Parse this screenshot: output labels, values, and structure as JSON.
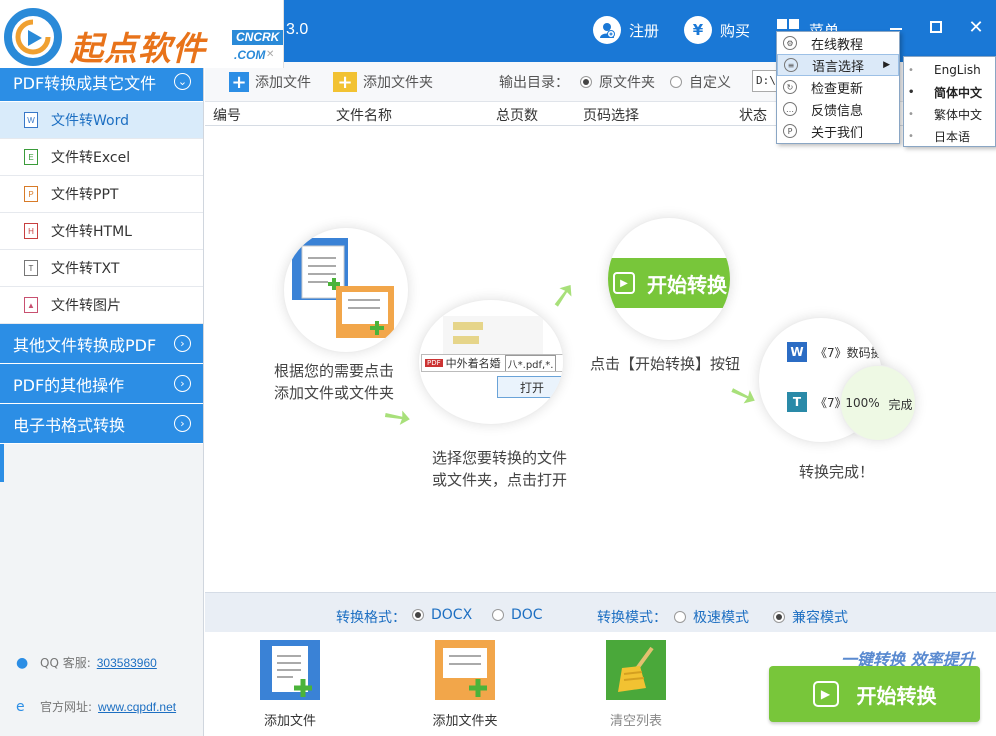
{
  "app": {
    "logo_text": "起点软件",
    "logo_badge": "CNCRK",
    "logo_domain": ".COM",
    "version_suffix": "3.0"
  },
  "titlebar": {
    "register": "注册",
    "buy": "购买",
    "menu": "菜单"
  },
  "dropdown": {
    "items": [
      "在线教程",
      "语言选择",
      "检查更新",
      "反馈信息",
      "关于我们"
    ]
  },
  "language_submenu": {
    "items": [
      "EngLish",
      "简体中文",
      "繁体中文",
      "日本语"
    ],
    "selected": "简体中文"
  },
  "sidebar": {
    "categories": [
      {
        "label": "PDF转换成其它文件",
        "expanded": true
      },
      {
        "label": "其他文件转换成PDF",
        "expanded": false
      },
      {
        "label": "PDF的其他操作",
        "expanded": false
      },
      {
        "label": "电子书格式转换",
        "expanded": false
      }
    ],
    "sub_items": [
      "文件转Word",
      "文件转Excel",
      "文件转PPT",
      "文件转HTML",
      "文件转TXT",
      "文件转图片"
    ],
    "active_sub": "文件转Word",
    "qq_label": "QQ 客服:",
    "qq_number": "303583960",
    "site_label": "官方网址:",
    "site_url": "www.cqpdf.net"
  },
  "toolbar": {
    "add_file": "添加文件",
    "add_folder": "添加文件夹",
    "output_label": "输出目录：",
    "opt_original": "原文件夹",
    "opt_custom": "自定义",
    "path_value": "D:\\t"
  },
  "table": {
    "headers": [
      "编号",
      "文件名称",
      "总页数",
      "页码选择",
      "状态"
    ]
  },
  "guide": {
    "step1": [
      "根据您的需要点击",
      "添加文件或文件夹"
    ],
    "step2": [
      "选择您要转换的文件",
      "或文件夹，点击打开"
    ],
    "step3": "点击【开始转换】按钮",
    "step4": "转换完成！",
    "demo_start": "开始转换",
    "demo_filename": "中外着名婚",
    "demo_filter": "八*.pdf,*.",
    "demo_open": "打开",
    "demo_doc1": "《7》数码摄",
    "demo_doc2": "《7》",
    "demo_progress": "100%",
    "demo_done": "完成"
  },
  "format": {
    "label": "转换格式：",
    "docx": "DOCX",
    "doc": "DOC",
    "selected": "DOCX",
    "mode_label": "转换模式：",
    "fast": "极速模式",
    "compat": "兼容模式",
    "mode_selected": "兼容模式"
  },
  "actions": {
    "add_file": "添加文件",
    "add_folder": "添加文件夹",
    "clear": "清空列表",
    "slogan": "一键转换  效率提升",
    "start": "开始转换"
  },
  "colors": {
    "titlebar": "#1a78d6",
    "sidebar_blue": "#2c8ee5",
    "start_green": "#78c63a",
    "logo_orange": "#e8731a"
  }
}
